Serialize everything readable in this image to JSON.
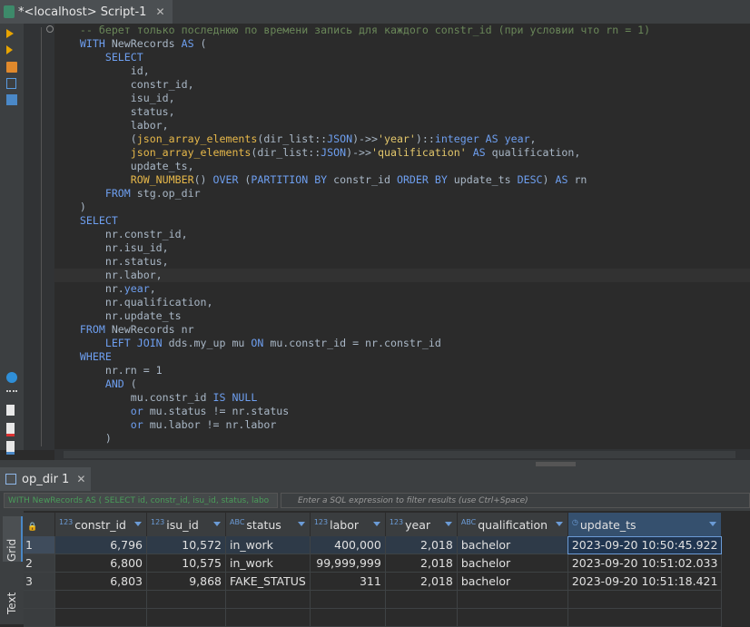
{
  "editor_tab": {
    "title": "*<localhost> Script-1",
    "close": "✕"
  },
  "code_lines": [
    [
      [
        "cmt",
        "    -- берет только последнюю по времени запись для каждого constr_id (при условии что rn = 1)"
      ]
    ],
    [
      [
        "kw",
        "    WITH "
      ],
      [
        "pl",
        "NewRecords "
      ],
      [
        "kw",
        "AS"
      ],
      [
        "pl",
        " ("
      ]
    ],
    [
      [
        "kw",
        "        SELECT"
      ]
    ],
    [
      [
        "pl",
        "            id,"
      ]
    ],
    [
      [
        "pl",
        "            constr_id,"
      ]
    ],
    [
      [
        "pl",
        "            isu_id,"
      ]
    ],
    [
      [
        "pl",
        "            status,"
      ]
    ],
    [
      [
        "pl",
        "            labor,"
      ]
    ],
    [
      [
        "pl",
        "            ("
      ],
      [
        "fn",
        "json_array_elements"
      ],
      [
        "pl",
        "(dir_list::"
      ],
      [
        "kw",
        "JSON"
      ],
      [
        "pl",
        ")->>"
      ],
      [
        "str",
        "'year'"
      ],
      [
        "pl",
        ")::"
      ],
      [
        "kw",
        "integer AS year"
      ],
      [
        "pl",
        ","
      ]
    ],
    [
      [
        "fn",
        "            json_array_elements"
      ],
      [
        "pl",
        "(dir_list::"
      ],
      [
        "kw",
        "JSON"
      ],
      [
        "pl",
        ")->>"
      ],
      [
        "str",
        "'qualification'"
      ],
      [
        "kw",
        " AS "
      ],
      [
        "pl",
        "qualification,"
      ]
    ],
    [
      [
        "pl",
        "            update_ts,"
      ]
    ],
    [
      [
        "fn",
        "            ROW_NUMBER"
      ],
      [
        "pl",
        "() "
      ],
      [
        "kw",
        "OVER"
      ],
      [
        "pl",
        " ("
      ],
      [
        "kw",
        "PARTITION BY "
      ],
      [
        "pl",
        "constr_id "
      ],
      [
        "kw",
        "ORDER BY "
      ],
      [
        "pl",
        "update_ts "
      ],
      [
        "kw",
        "DESC"
      ],
      [
        "pl",
        ") "
      ],
      [
        "kw",
        "AS "
      ],
      [
        "pl",
        "rn"
      ]
    ],
    [
      [
        "kw",
        "        FROM "
      ],
      [
        "pl",
        "stg.op_dir"
      ]
    ],
    [
      [
        "pl",
        "    )"
      ]
    ],
    [
      [
        "kw",
        "    SELECT"
      ]
    ],
    [
      [
        "pl",
        "        nr.constr_id,"
      ]
    ],
    [
      [
        "pl",
        "        nr.isu_id,"
      ]
    ],
    [
      [
        "pl",
        "        nr.status,"
      ]
    ],
    [
      [
        "pl",
        "        nr.labor,"
      ]
    ],
    [
      [
        "pl",
        "        nr."
      ],
      [
        "kw",
        "year"
      ],
      [
        "pl",
        ","
      ]
    ],
    [
      [
        "pl",
        "        nr.qualification,"
      ]
    ],
    [
      [
        "pl",
        "        nr.update_ts"
      ]
    ],
    [
      [
        "kw",
        "    FROM "
      ],
      [
        "pl",
        "NewRecords nr"
      ]
    ],
    [
      [
        "kw",
        "        LEFT JOIN "
      ],
      [
        "pl",
        "dds.my_up mu "
      ],
      [
        "kw",
        "ON "
      ],
      [
        "pl",
        "mu.constr_id = nr.constr_id"
      ]
    ],
    [
      [
        "kw",
        "    WHERE"
      ]
    ],
    [
      [
        "pl",
        "        nr.rn = 1"
      ]
    ],
    [
      [
        "kw",
        "        AND"
      ],
      [
        "pl",
        " ("
      ]
    ],
    [
      [
        "pl",
        "            mu.constr_id "
      ],
      [
        "kw",
        "IS NULL"
      ]
    ],
    [
      [
        "kw",
        "            or "
      ],
      [
        "pl",
        "mu.status != nr.status"
      ]
    ],
    [
      [
        "kw",
        "            or "
      ],
      [
        "pl",
        "mu.labor != nr.labor"
      ]
    ],
    [
      [
        "pl",
        "        )"
      ]
    ]
  ],
  "results_tab": {
    "title": "op_dir 1",
    "close": "✕"
  },
  "filter": {
    "query_text": "WITH NewRecords AS ( SELECT id, constr_id, isu_id, status, labo",
    "placeholder": "Enter a SQL expression to filter results (use Ctrl+Space)"
  },
  "side_tabs": {
    "grid": "Grid",
    "text": "Text"
  },
  "grid": {
    "columns": [
      {
        "type": "123",
        "name": "constr_id"
      },
      {
        "type": "123",
        "name": "isu_id"
      },
      {
        "type": "ABC",
        "name": "status"
      },
      {
        "type": "123",
        "name": "labor"
      },
      {
        "type": "123",
        "name": "year"
      },
      {
        "type": "ABC",
        "name": "qualification"
      },
      {
        "type": "clock",
        "name": "update_ts"
      }
    ],
    "rows": [
      {
        "n": "1",
        "constr_id": "6,796",
        "isu_id": "10,572",
        "status": "in_work",
        "labor": "400,000",
        "year": "2,018",
        "qualification": "bachelor",
        "update_ts": "2023-09-20 10:50:45.922"
      },
      {
        "n": "2",
        "constr_id": "6,800",
        "isu_id": "10,575",
        "status": "in_work",
        "labor": "99,999,999",
        "year": "2,018",
        "qualification": "bachelor",
        "update_ts": "2023-09-20 10:51:02.033"
      },
      {
        "n": "3",
        "constr_id": "6,803",
        "isu_id": "9,868",
        "status": "FAKE_STATUS",
        "labor": "311",
        "year": "2,018",
        "qualification": "bachelor",
        "update_ts": "2023-09-20 10:51:18.421"
      }
    ]
  },
  "colors": {
    "keyword": "#6e9ff0",
    "function": "#e7b84a",
    "comment": "#6a8759",
    "accent": "#4a88c7"
  }
}
